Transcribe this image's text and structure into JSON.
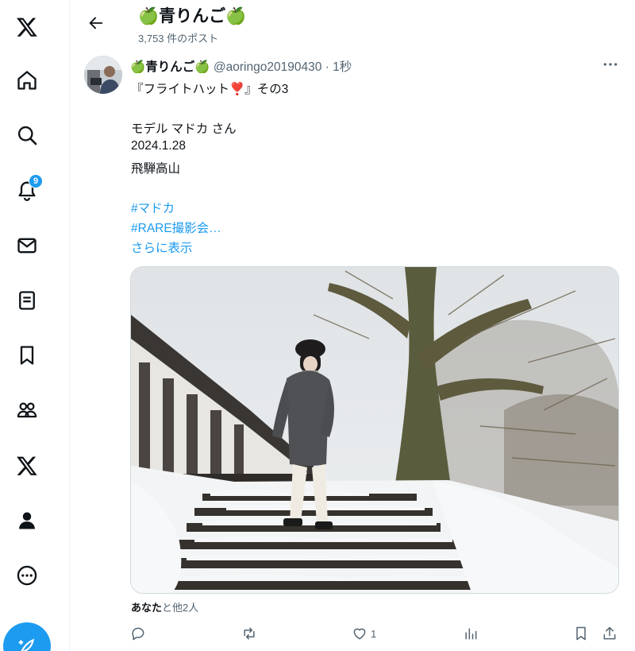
{
  "header": {
    "title": "🍏青りんご🍏",
    "post_count": "3,753 件のポスト"
  },
  "nav": {
    "notification_badge": "9",
    "items": [
      "x-logo",
      "home",
      "explore",
      "notifications",
      "messages",
      "lists",
      "bookmarks",
      "communities",
      "premium",
      "profile",
      "more"
    ]
  },
  "post": {
    "author_name": "🍏青りんご🍏",
    "handle": "@aoringo20190430",
    "separator": "·",
    "time": "1秒",
    "lines": [
      "『フライトハット❣️』その3",
      "モデル マドカ さん",
      "2024.1.28",
      "飛騨高山"
    ],
    "hashtags": [
      "#マドカ",
      "#RARE撮影会…"
    ],
    "show_more": "さらに表示",
    "liked_by_name": "あなた",
    "liked_by_rest": "と他2人",
    "like_count": "1"
  },
  "colors": {
    "accent": "#1d9bf0",
    "text": "#0f1419",
    "secondary": "#536471"
  }
}
